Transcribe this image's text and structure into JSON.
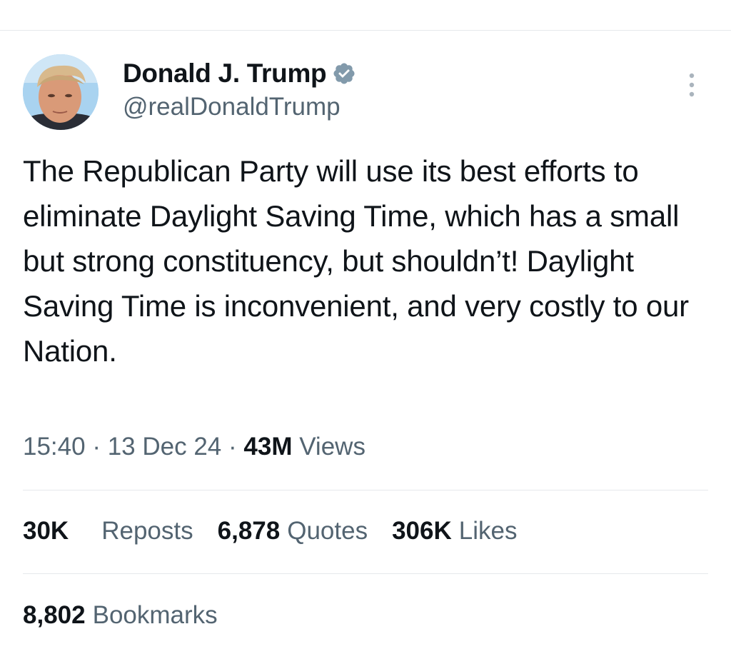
{
  "author": {
    "display_name": "Donald J. Trump",
    "handle": "@realDonaldTrump",
    "verified": true,
    "verified_color": "#829aab"
  },
  "tweet": {
    "text": "The Republican Party will use its best efforts to eliminate Daylight Saving Time, which has a small but strong constituency, but shouldn’t! Daylight Saving Time is inconvenient, and very costly to our Nation.",
    "time": "15:40",
    "date": "13 Dec 24",
    "separator": "·",
    "views_count": "43M",
    "views_label": "Views"
  },
  "stats": {
    "reposts_count": "30K",
    "reposts_label": "Reposts",
    "quotes_count": "6,878",
    "quotes_label": "Quotes",
    "likes_count": "306K",
    "likes_label": "Likes",
    "bookmarks_count": "8,802",
    "bookmarks_label": "Bookmarks"
  },
  "icons": {
    "more": "more-vertical-icon",
    "verified": "verified-badge-icon"
  },
  "colors": {
    "text_primary": "#0f1419",
    "text_secondary": "#536471",
    "divider": "#e6e9ec"
  }
}
